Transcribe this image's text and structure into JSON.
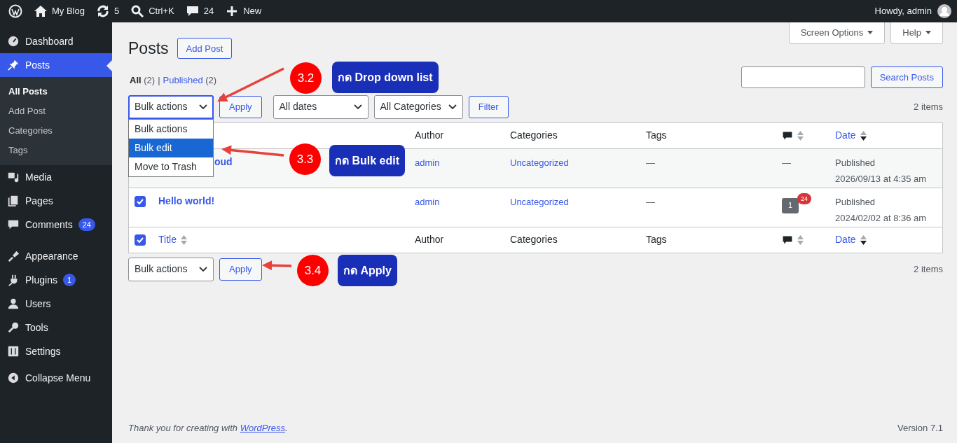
{
  "admin_bar": {
    "items": [
      {
        "kind": "logo"
      },
      {
        "kind": "home",
        "label": "My Blog"
      },
      {
        "kind": "updates",
        "label": "5"
      },
      {
        "kind": "search",
        "label": "Ctrl+K"
      },
      {
        "kind": "comments",
        "label": "24"
      },
      {
        "kind": "new",
        "label": "New"
      }
    ],
    "greeting": "Howdy, admin"
  },
  "sidebar": {
    "groups": [
      [
        {
          "kind": "dashboard",
          "label": "Dashboard",
          "selected": false
        },
        {
          "kind": "posts",
          "label": "Posts",
          "selected": true,
          "children": [
            {
              "label": "All Posts",
              "selected": true
            },
            {
              "label": "Add Post",
              "selected": false
            },
            {
              "label": "Categories",
              "selected": false
            },
            {
              "label": "Tags",
              "selected": false
            }
          ]
        },
        {
          "kind": "media",
          "label": "Media",
          "selected": false
        },
        {
          "kind": "pages",
          "label": "Pages",
          "selected": false
        },
        {
          "kind": "comments",
          "label": "Comments",
          "selected": false,
          "badge": "24"
        }
      ],
      [
        {
          "kind": "appearance",
          "label": "Appearance",
          "selected": false
        },
        {
          "kind": "plugins",
          "label": "Plugins",
          "selected": false,
          "badge": "1"
        },
        {
          "kind": "users",
          "label": "Users",
          "selected": false
        },
        {
          "kind": "tools",
          "label": "Tools",
          "selected": false
        },
        {
          "kind": "settings",
          "label": "Settings",
          "selected": false
        }
      ]
    ],
    "collapse": "Collapse Menu"
  },
  "screen_meta": [
    "Screen Options",
    "Help"
  ],
  "page": {
    "title": "Posts",
    "add_button": "Add Post",
    "views": [
      {
        "label": "All",
        "count": "(2)",
        "selected": true
      },
      {
        "label": "Published",
        "count": "(2)",
        "selected": false
      }
    ],
    "views_separator": "|",
    "search_button": "Search Posts"
  },
  "top_nav": {
    "bulk": {
      "label": "Bulk actions",
      "expanded": true,
      "options": [
        {
          "label": "Bulk actions",
          "selected": false
        },
        {
          "label": "Bulk edit",
          "selected": true
        },
        {
          "label": "Move to Trash",
          "selected": false
        }
      ]
    },
    "apply": "Apply",
    "filters": [
      "All dates",
      "All Categories"
    ],
    "filter_button": "Filter",
    "count": "2 items"
  },
  "table": {
    "header": [
      {
        "kind": "author",
        "label": "Author"
      },
      {
        "kind": "categories",
        "label": "Categories"
      },
      {
        "kind": "tags",
        "label": "Tags"
      },
      {
        "kind": "comments",
        "sorted": false
      },
      {
        "kind": "date",
        "label": "Date",
        "sorted": true
      }
    ],
    "rows": [
      {
        "title": "oud",
        "author": "admin",
        "categories": "Uncategorized",
        "tags": "—",
        "comments": {
          "kind": "none",
          "text": "—"
        },
        "status": "Published",
        "date": "2026/09/13 at 4:35 am"
      },
      {
        "checked": true,
        "title": "Hello world!",
        "author": "admin",
        "categories": "Uncategorized",
        "tags": "—",
        "comments": {
          "kind": "bubble",
          "count": "1",
          "pending": "24"
        },
        "status": "Published",
        "date": "2024/02/02 at 8:36 am"
      }
    ],
    "footer": [
      {
        "kind": "checkbox",
        "checked": true
      },
      {
        "kind": "title",
        "label": "Title",
        "sorted": false
      },
      {
        "kind": "author",
        "label": "Author"
      },
      {
        "kind": "categories",
        "label": "Categories"
      },
      {
        "kind": "tags",
        "label": "Tags"
      },
      {
        "kind": "comments",
        "sorted": false
      },
      {
        "kind": "date",
        "label": "Date",
        "sorted": true
      }
    ]
  },
  "bottom_nav": {
    "bulk": "Bulk actions",
    "apply": "Apply",
    "count": "2 items"
  },
  "footer": {
    "text_before": "Thank you for creating with ",
    "link": "WordPress",
    "text_after": ".",
    "version": "Version 7.1"
  },
  "annotations": [
    {
      "number": "3.2",
      "label": "กด Drop down list"
    },
    {
      "number": "3.3",
      "label": "กด Bulk edit"
    },
    {
      "number": "3.4",
      "label": "กด Apply"
    }
  ]
}
